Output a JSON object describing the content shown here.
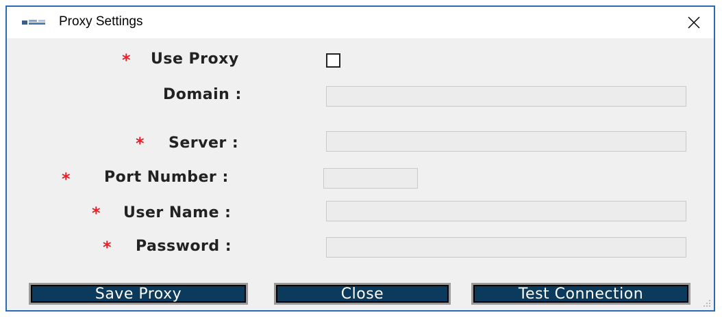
{
  "window": {
    "title": "Proxy Settings",
    "accent": "#2a69b5"
  },
  "form": {
    "required_mark": "*",
    "use_proxy": {
      "label": "Use Proxy",
      "checked": false
    },
    "domain": {
      "label": "Domain :",
      "value": ""
    },
    "server": {
      "label": "Server :",
      "value": ""
    },
    "port": {
      "label": "Port Number :",
      "value": ""
    },
    "username": {
      "label": "User Name :",
      "value": ""
    },
    "password": {
      "label": "Password :",
      "value": ""
    }
  },
  "buttons": {
    "save": "Save Proxy",
    "close": "Close",
    "test": "Test Connection"
  },
  "colors": {
    "button_bg": "#0b3a5c",
    "required": "#e8202a",
    "dialog_bg": "#f0f0f0"
  },
  "icons": {
    "app": "app-logo-icon",
    "close": "close-icon",
    "resize": "resize-grip-icon"
  }
}
